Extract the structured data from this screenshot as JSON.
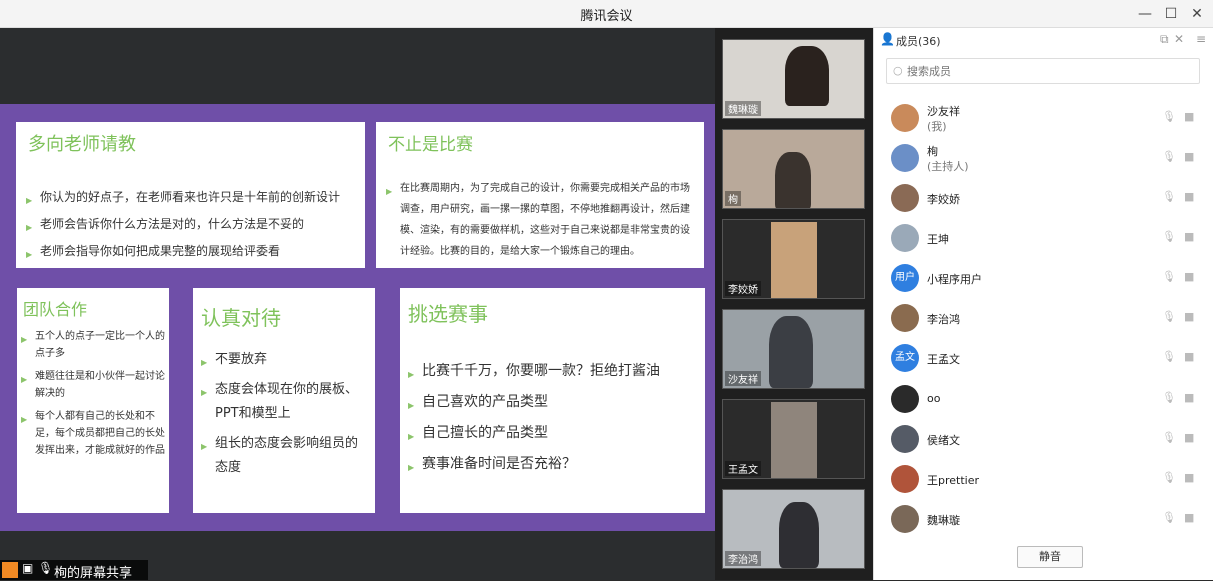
{
  "window": {
    "title": "腾讯会议",
    "minimize": "—",
    "maximize": "☐",
    "close": "✕"
  },
  "slide": {
    "card1": {
      "title": "多向老师请教",
      "items": [
        "你认为的好点子，在老师看来也许只是十年前的创新设计",
        "老师会告诉你什么方法是对的，什么方法是不妥的",
        "老师会指导你如何把成果完整的展现给评委看"
      ]
    },
    "card2": {
      "title": "不止是比赛",
      "items": [
        "在比赛周期内，为了完成自己的设计，你需要完成相关产品的市场调查，用户研究，画一摞一摞的草图，不停地推翻再设计，然后建模、渲染，有的需要做样机，这些对于自己来说都是非常宝贵的设计经验。比赛的目的，是给大家一个锻炼自己的理由。"
      ]
    },
    "card3": {
      "title": "团队合作",
      "items": [
        "五个人的点子一定比一个人的点子多",
        "难题往往是和小伙伴一起讨论解决的",
        "每个人都有自己的长处和不足，每个成员都把自己的长处发挥出来，才能成就好的作品"
      ]
    },
    "card4": {
      "title": "认真对待",
      "items": [
        "不要放弃",
        "态度会体现在你的展板、PPT和模型上",
        "组长的态度会影响组员的态度"
      ]
    },
    "card5": {
      "title": "挑选赛事",
      "items": [
        "比赛千千万，你要哪一款？拒绝打酱油",
        "自己喜欢的产品类型",
        "自己擅长的产品类型",
        "赛事准备时间是否充裕？"
      ]
    }
  },
  "share_status": {
    "label": "栒的屏幕共享"
  },
  "video_tiles": [
    {
      "name": "魏琳璇"
    },
    {
      "name": "栒"
    },
    {
      "name": "李姣娇"
    },
    {
      "name": "沙友祥"
    },
    {
      "name": "王孟文"
    },
    {
      "name": "李治鸿"
    }
  ],
  "members_panel": {
    "header": "成员(36)",
    "search_placeholder": "搜索成员",
    "members": [
      {
        "name": "沙友祥",
        "role": "(我)",
        "avatar_color": "#c98a5b"
      },
      {
        "name": "栒",
        "role": "(主持人)",
        "avatar_color": "#6b8fc7"
      },
      {
        "name": "李姣娇",
        "role": "",
        "avatar_color": "#8a6a55"
      },
      {
        "name": "王坤",
        "role": "",
        "avatar_color": "#9aa9b8"
      },
      {
        "name": "小程序用户",
        "role": "",
        "avatar_color": "#2f7fe0",
        "avatar_text": "用户"
      },
      {
        "name": "李治鸿",
        "role": "",
        "avatar_color": "#8a6b4f"
      },
      {
        "name": "王孟文",
        "role": "",
        "avatar_color": "#2f7fe0",
        "avatar_text": "孟文"
      },
      {
        "name": "oo",
        "role": "",
        "avatar_color": "#2a2a2a"
      },
      {
        "name": "侯绪文",
        "role": "",
        "avatar_color": "#555b66"
      },
      {
        "name": "王prettier",
        "role": "",
        "avatar_color": "#b0543a"
      },
      {
        "name": "魏琳璇",
        "role": "",
        "avatar_color": "#7a6858"
      }
    ],
    "mute_all": "静音"
  }
}
